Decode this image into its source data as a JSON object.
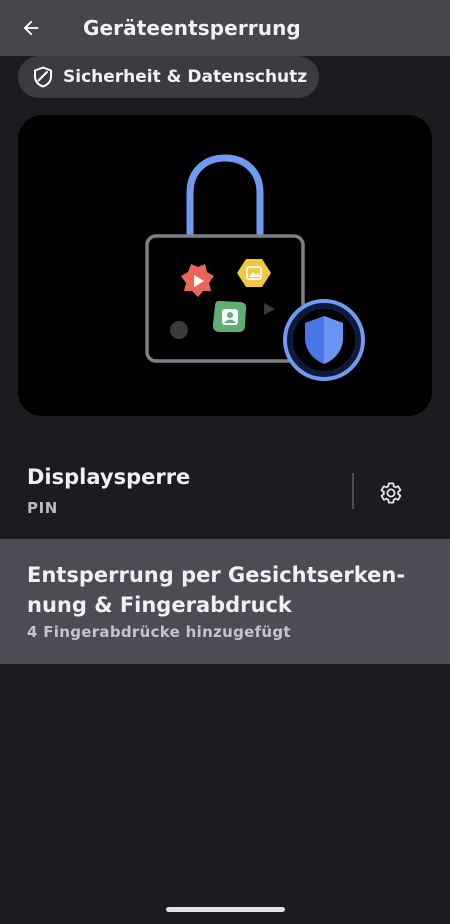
{
  "topbar": {
    "title": "Geräteentsperrung",
    "back_icon": "arrow-back-icon"
  },
  "breadcrumb_chip": {
    "label": "Sicherheit & Datenschutz",
    "icon": "shield-icon"
  },
  "screen_lock": {
    "title": "Displaysperre",
    "value": "PIN",
    "settings_icon": "gear-icon"
  },
  "face_fingerprint": {
    "title": "Entsperrung per Gesichtserken-nung & Fingerabdruck",
    "subtitle": "4 Fingerabdrücke hinzugefügt"
  },
  "colors": {
    "topbar_bg": "#46474c",
    "page_bg": "#1b1c20",
    "highlight_row_bg": "#4b4c54",
    "lock_shackle": "#6f9bf0",
    "shield_blue": "#3f6ee0"
  }
}
